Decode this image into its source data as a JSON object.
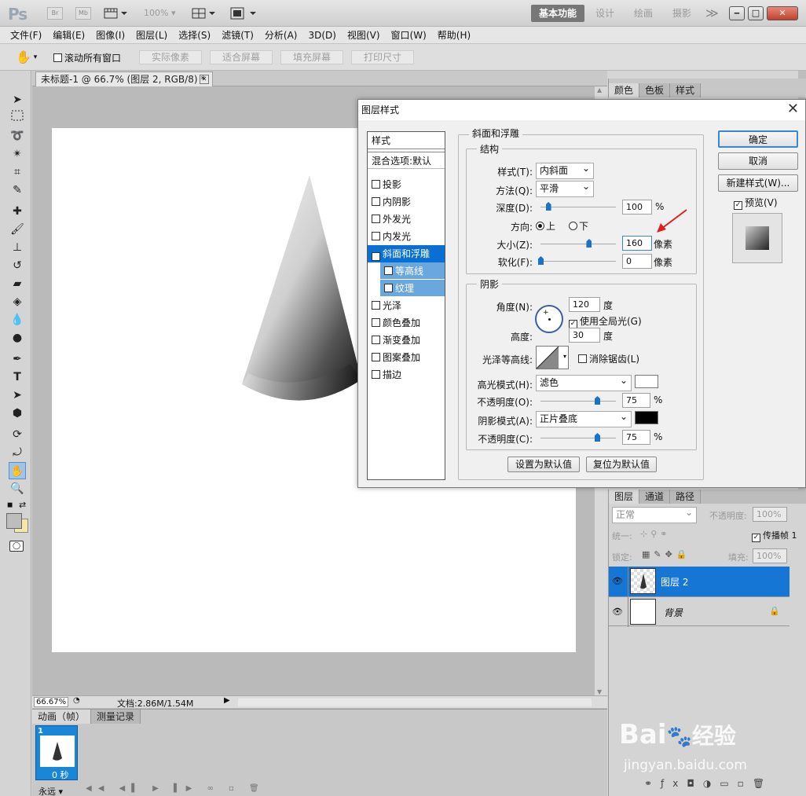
{
  "app": {
    "logo": "Ps",
    "mini_br": "Br",
    "mini_mb": "Mb",
    "zoom": "100%",
    "workspaces": [
      "基本功能",
      "设计",
      "绘画",
      "摄影"
    ],
    "more": "≫",
    "win_min": "‒",
    "win_max": "□",
    "win_close": "✕"
  },
  "menu": [
    "文件(F)",
    "编辑(E)",
    "图像(I)",
    "图层(L)",
    "选择(S)",
    "滤镜(T)",
    "分析(A)",
    "3D(D)",
    "视图(V)",
    "窗口(W)",
    "帮助(H)"
  ],
  "options": {
    "scroll_all": "滚动所有窗口",
    "buttons": [
      "实际像素",
      "适合屏幕",
      "填充屏幕",
      "打印尺寸"
    ]
  },
  "document": {
    "tab_title": "未标题-1 @ 66.7% (图层 2, RGB/8) *",
    "tab_close": "✕",
    "zoom_status": "66.67%",
    "doc_size": "文档:2.86M/1.54M"
  },
  "anim_panel": {
    "tabs": [
      "动画（帧）",
      "测量记录"
    ],
    "frame_num": "1",
    "frame_time": "0 秒",
    "loop": "永远"
  },
  "right_panel_top": {
    "tabs": [
      "颜色",
      "色板",
      "样式"
    ]
  },
  "layers_panel": {
    "tabs": [
      "图层",
      "通道",
      "路径"
    ],
    "blend_mode": "正常",
    "opacity_label": "不透明度:",
    "opacity_value": "100%",
    "unify_label": "统一:",
    "propagate": "传播帧 1",
    "lock_label": "锁定:",
    "fill_label": "填充:",
    "fill_value": "100%",
    "layers": [
      {
        "name": "图层 2",
        "selected": true
      },
      {
        "name": "背景",
        "selected": false
      }
    ]
  },
  "dialog": {
    "title": "图层样式",
    "close": "✕",
    "style_list": {
      "header": "样式",
      "blend_options": "混合选项:默认",
      "items": [
        {
          "label": "投影",
          "checked": false,
          "active": false,
          "sub": false
        },
        {
          "label": "内阴影",
          "checked": false,
          "active": false,
          "sub": false
        },
        {
          "label": "外发光",
          "checked": false,
          "active": false,
          "sub": false
        },
        {
          "label": "内发光",
          "checked": false,
          "active": false,
          "sub": false
        },
        {
          "label": "斜面和浮雕",
          "checked": true,
          "active": true,
          "sub": false
        },
        {
          "label": "等高线",
          "checked": false,
          "active": false,
          "sub": true
        },
        {
          "label": "纹理",
          "checked": false,
          "active": false,
          "sub": true
        },
        {
          "label": "光泽",
          "checked": false,
          "active": false,
          "sub": false
        },
        {
          "label": "颜色叠加",
          "checked": false,
          "active": false,
          "sub": false
        },
        {
          "label": "渐变叠加",
          "checked": false,
          "active": false,
          "sub": false
        },
        {
          "label": "图案叠加",
          "checked": false,
          "active": false,
          "sub": false
        },
        {
          "label": "描边",
          "checked": false,
          "active": false,
          "sub": false
        }
      ]
    },
    "bevel": {
      "group_title": "斜面和浮雕",
      "structure_title": "结构",
      "style_label": "样式(T):",
      "style_value": "内斜面",
      "technique_label": "方法(Q):",
      "technique_value": "平滑",
      "depth_label": "深度(D):",
      "depth_value": "100",
      "depth_unit": "%",
      "depth_level": 0.1,
      "direction_label": "方向:",
      "dir_up": "上",
      "dir_down": "下",
      "size_label": "大小(Z):",
      "size_value": "160",
      "size_unit": "像素",
      "size_level": 0.64,
      "soften_label": "软化(F):",
      "soften_value": "0",
      "soften_unit": "像素",
      "soften_level": 0.0
    },
    "shading": {
      "title": "阴影",
      "angle_label": "角度(N):",
      "angle_value": "120",
      "angle_unit": "度",
      "global_light": "使用全局光(G)",
      "altitude_label": "高度:",
      "altitude_value": "30",
      "altitude_unit": "度",
      "gloss_label": "光泽等高线:",
      "anti_alias": "消除锯齿(L)",
      "highlight_label": "高光模式(H):",
      "highlight_value": "滤色",
      "highlight_color": "#ffffff",
      "highlight_opacity_label": "不透明度(O):",
      "highlight_opacity": "75",
      "highlight_opacity_level": 0.75,
      "shadow_label": "阴影模式(A):",
      "shadow_value": "正片叠底",
      "shadow_color": "#000000",
      "shadow_opacity_label": "不透明度(C):",
      "shadow_opacity": "75",
      "shadow_opacity_level": 0.75,
      "pct": "%"
    },
    "make_default": "设置为默认值",
    "reset_default": "复位为默认值",
    "ok": "确定",
    "cancel": "取消",
    "new_style": "新建样式(W)...",
    "preview": "预览(V)"
  },
  "watermark": {
    "brand": "Bai",
    "brand2": "经验",
    "url": "jingyan.baidu.com"
  },
  "colors": {
    "accent": "#0a6fd2",
    "sub_item": "#6aa7de",
    "arrow": "#e02020"
  }
}
